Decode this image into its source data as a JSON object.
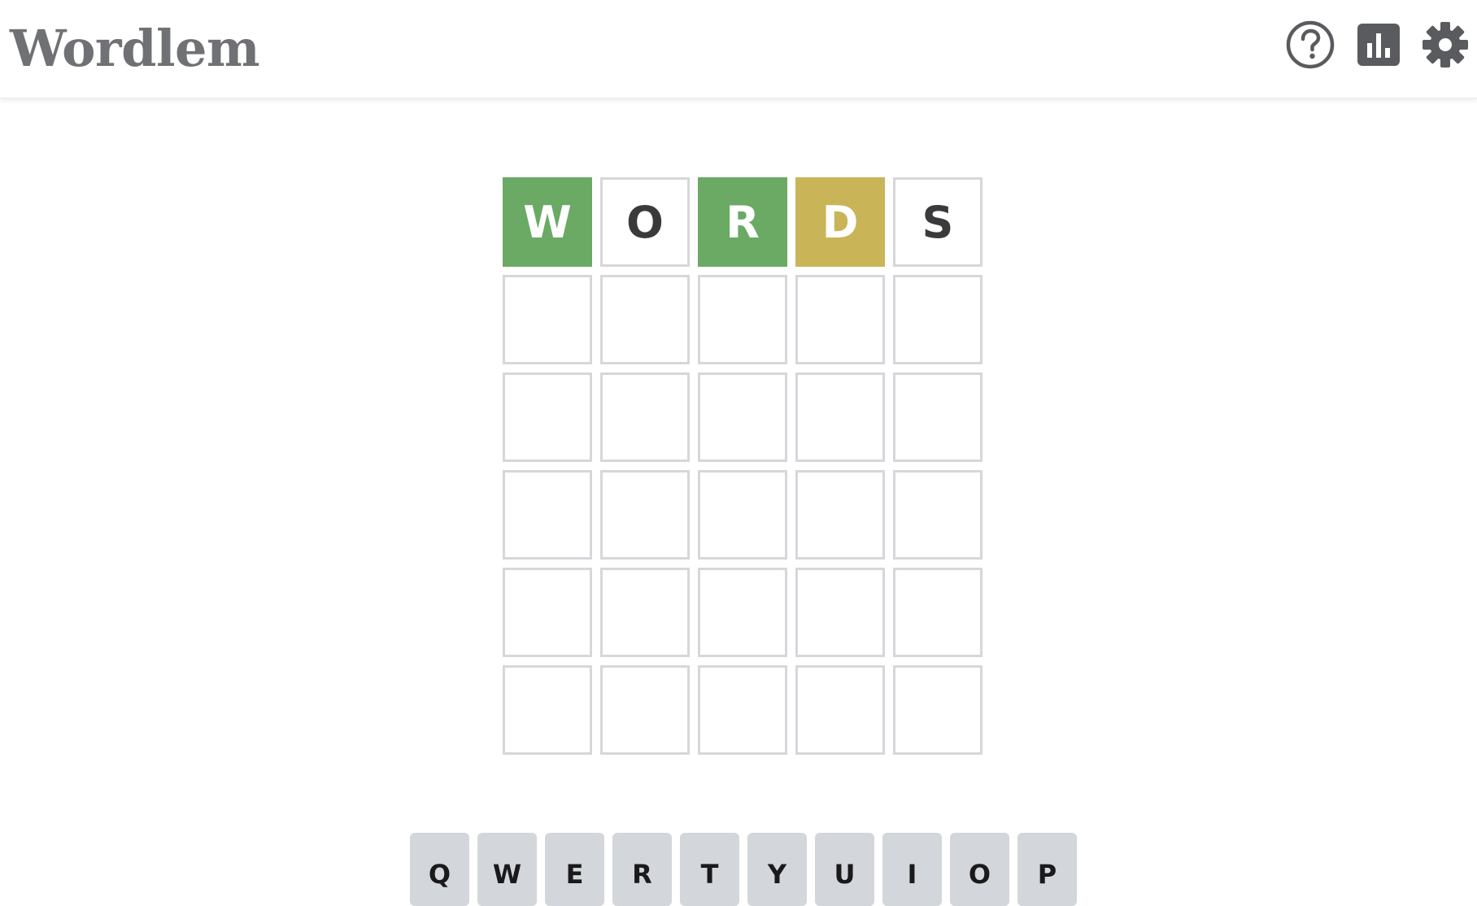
{
  "header": {
    "title": "Wordlem",
    "icons": [
      "help-icon",
      "stats-icon",
      "settings-icon"
    ]
  },
  "colors": {
    "correct": "#6aaa64",
    "present": "#c9b458",
    "empty_border": "#d6d7da",
    "key": "#d3d6da",
    "title": "#6f7174",
    "icon": "#5a5b5e"
  },
  "board": {
    "rows": [
      [
        {
          "letter": "W",
          "state": "correct"
        },
        {
          "letter": "O",
          "state": "absent"
        },
        {
          "letter": "R",
          "state": "correct"
        },
        {
          "letter": "D",
          "state": "present"
        },
        {
          "letter": "S",
          "state": "absent"
        }
      ],
      [
        {
          "letter": "",
          "state": "empty"
        },
        {
          "letter": "",
          "state": "empty"
        },
        {
          "letter": "",
          "state": "empty"
        },
        {
          "letter": "",
          "state": "empty"
        },
        {
          "letter": "",
          "state": "empty"
        }
      ],
      [
        {
          "letter": "",
          "state": "empty"
        },
        {
          "letter": "",
          "state": "empty"
        },
        {
          "letter": "",
          "state": "empty"
        },
        {
          "letter": "",
          "state": "empty"
        },
        {
          "letter": "",
          "state": "empty"
        }
      ],
      [
        {
          "letter": "",
          "state": "empty"
        },
        {
          "letter": "",
          "state": "empty"
        },
        {
          "letter": "",
          "state": "empty"
        },
        {
          "letter": "",
          "state": "empty"
        },
        {
          "letter": "",
          "state": "empty"
        }
      ],
      [
        {
          "letter": "",
          "state": "empty"
        },
        {
          "letter": "",
          "state": "empty"
        },
        {
          "letter": "",
          "state": "empty"
        },
        {
          "letter": "",
          "state": "empty"
        },
        {
          "letter": "",
          "state": "empty"
        }
      ],
      [
        {
          "letter": "",
          "state": "empty"
        },
        {
          "letter": "",
          "state": "empty"
        },
        {
          "letter": "",
          "state": "empty"
        },
        {
          "letter": "",
          "state": "empty"
        },
        {
          "letter": "",
          "state": "empty"
        }
      ]
    ]
  },
  "keyboard": {
    "row1": [
      "Q",
      "W",
      "E",
      "R",
      "T",
      "Y",
      "U",
      "I",
      "O",
      "P"
    ]
  }
}
